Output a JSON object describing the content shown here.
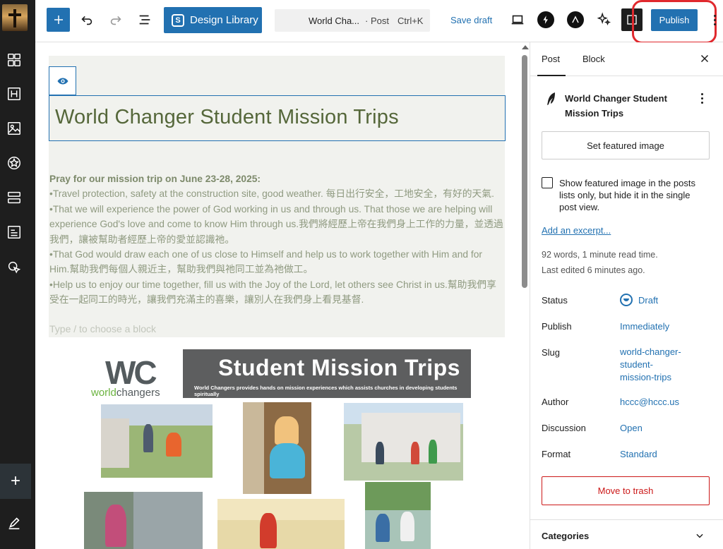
{
  "toolbar": {
    "design_library_label": "Design Library",
    "command_title": "World Cha...",
    "command_post_type": "· Post",
    "command_shortcut": "Ctrl+K",
    "save_draft_label": "Save draft",
    "publish_label": "Publish"
  },
  "colors": {
    "accent": "#2271b1",
    "rail_background": "#1e1e1e",
    "title_green": "#55673a",
    "group_background": "#f1f2ee",
    "danger": "#cc1818",
    "annotation_circle": "#e0292e"
  },
  "rail": {
    "icons": [
      "site-icon",
      "patterns-icon",
      "heading-icon",
      "media-icon",
      "styles-icon",
      "blocks-icon",
      "page-list-icon",
      "cursor-click-icon",
      "add-block-icon",
      "edit-icon"
    ]
  },
  "editor": {
    "post_title": "World Changer Student Mission Trips",
    "prayer_heading": "Pray for our mission trip on June 23-28, 2025:",
    "prayer_lines": [
      "•Travel protection, safety at the construction site, good weather. 每日出行安全，工地安全，有好的天氣.",
      "•That we will experience the power of God working in us and through us.  That those we are helping will experience God's love and come to know Him through us.我們將經歷上帝在我們身上工作的力量，並透過我們，讓被幫助者經歷上帝的愛並認識祂。",
      "•That God would draw each one of us close to Himself and help us to work together with Him and for Him.幫助我們每個人親近主，幫助我們與祂同工並為祂做工。",
      "•Help us to enjoy our time together, fill us with the Joy of the Lord, let others see Christ in us.幫助我們享受在一起同工的時光，讓我們充滿主的喜樂，讓別人在我們身上看見基督."
    ],
    "block_placeholder": "Type / to choose a block",
    "image": {
      "logo_letters": "WC",
      "logo_word_part1": "world",
      "logo_word_part2": "changers",
      "banner_title": "Student Mission Trips",
      "banner_subtitle": "World Changers provides hands on mission experiences which assists churches in developing students spiritually"
    }
  },
  "sidebar": {
    "tabs": [
      "Post",
      "Block"
    ],
    "post_title": "World Changer Student Mission Trips",
    "set_featured_label": "Set featured image",
    "featured_checkbox_label": "Show featured image in the posts lists only, but hide it in the single post view.",
    "featured_checkbox_checked": false,
    "excerpt_link": "Add an excerpt...",
    "word_count": "92 words, 1 minute read time.",
    "last_edited": "Last edited 6 minutes ago.",
    "status_label": "Status",
    "status_value": "Draft",
    "publish_label": "Publish",
    "publish_value": "Immediately",
    "slug_label": "Slug",
    "slug_value_lines": [
      "world-changer-",
      "student-",
      "mission-trips"
    ],
    "author_label": "Author",
    "author_value": "hccc@hccc.us",
    "discussion_label": "Discussion",
    "discussion_value": "Open",
    "format_label": "Format",
    "format_value": "Standard",
    "trash_label": "Move to trash",
    "categories_label": "Categories"
  }
}
